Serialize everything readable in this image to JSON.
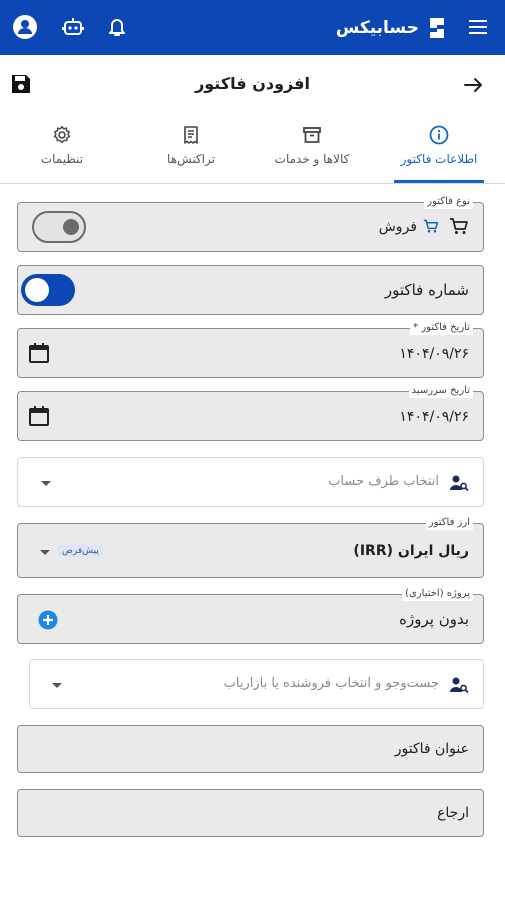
{
  "app": {
    "brand_name": "حسابیکس",
    "brand_color": "#0d47b6",
    "accent_color": "#1565c0"
  },
  "header": {
    "title": "افزودن فاکتور"
  },
  "tabs": [
    {
      "label": "اطلاعات فاکتور",
      "icon": "info-icon",
      "active": true
    },
    {
      "label": "کالاها و خدمات",
      "icon": "archive-box-icon",
      "active": false
    },
    {
      "label": "تراکنش‌ها",
      "icon": "receipt-icon",
      "active": false
    },
    {
      "label": "تنظیمات",
      "icon": "gear-icon",
      "active": false
    }
  ],
  "form": {
    "invoice_type": {
      "label": "نوع فاکتور",
      "value": "فروش"
    },
    "invoice_number": {
      "label": "شماره فاکتور",
      "toggle_on": true
    },
    "invoice_date": {
      "label": "تاریخ فاکتور *",
      "value": "۱۴۰۴/۰۹/۲۶"
    },
    "due_date": {
      "label": "تاریخ سررسید",
      "value": "۱۴۰۴/۰۹/۲۶"
    },
    "account": {
      "placeholder": "انتخاب طرف حساب"
    },
    "currency": {
      "label": "ارز فاکتور",
      "value": "ریال ایران (IRR)",
      "badge": "پیش‌فرض"
    },
    "project": {
      "label": "پروژه (اختیاری)",
      "value": "بدون پروژه"
    },
    "seller": {
      "placeholder": "جست‌وجو و انتخاب فروشنده یا بازاریاب"
    },
    "title": {
      "placeholder": "عنوان فاکتور"
    },
    "reference": {
      "placeholder": "ارجاع"
    }
  }
}
